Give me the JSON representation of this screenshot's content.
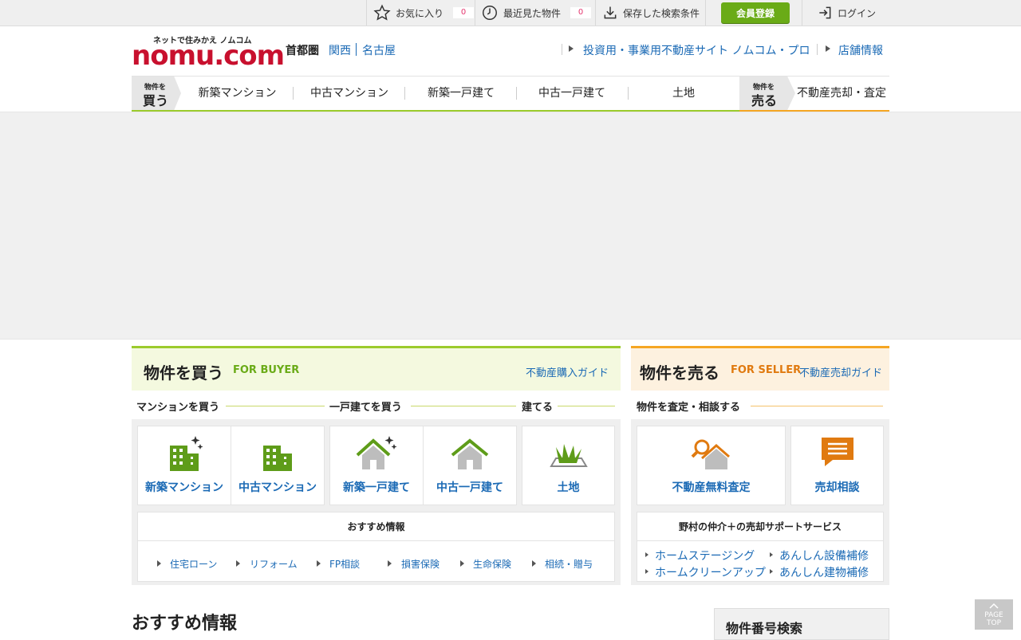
{
  "topbar": {
    "favorites_label": "お気に入り",
    "favorites_count": "0",
    "recent_label": "最近見た物件",
    "recent_count": "0",
    "saved_search_label": "保存した検索条件",
    "register_label": "会員登録",
    "login_label": "ログイン"
  },
  "header": {
    "logo_tagline": "ネットで住みかえ ノムコム",
    "logo_text": "nomu.com",
    "region_current": "首都圏",
    "region_kansai": "関西",
    "region_nagoya": "名古屋",
    "pro_site_link": "投資用・事業用不動産サイト ノムコム・プロ",
    "store_link": "店舗情報"
  },
  "gnav": {
    "buy_small": "物件を",
    "buy_large": "買う",
    "items": [
      "新築マンション",
      "中古マンション",
      "新築一戸建て",
      "中古一戸建て",
      "土地"
    ],
    "sell_small": "物件を",
    "sell_large": "売る",
    "sell_item": "不動産売却・査定"
  },
  "buyer": {
    "title": "物件を買う",
    "sub": "FOR BUYER",
    "guide": "不動産購入ガイド",
    "sub_mansion": "マンションを買う",
    "sub_house": "一戸建てを買う",
    "sub_build": "建てる",
    "cards": [
      "新築マンション",
      "中古マンション",
      "新築一戸建て",
      "中古一戸建て",
      "土地"
    ],
    "rec_title": "おすすめ情報",
    "rec_links": [
      "住宅ローン",
      "リフォーム",
      "FP相談",
      "損害保険",
      "生命保険",
      "相続・贈与"
    ]
  },
  "seller": {
    "title": "物件を売る",
    "sub": "FOR SELLER",
    "guide": "不動産売却ガイド",
    "sub_label": "物件を査定・相談する",
    "cards": [
      "不動産無料査定",
      "売却相談"
    ],
    "rec_title": "野村の仲介＋の売却サポートサービス",
    "rec_links": [
      "ホームステージング",
      "あんしん設備補修",
      "ホームクリーンアップ",
      "あんしん建物補修"
    ]
  },
  "bottom": {
    "section_title": "おすすめ情報",
    "number_search": "物件番号検索",
    "pagetop_line1": "PAGE",
    "pagetop_line2": "TOP"
  },
  "colors": {
    "green": "#9bcb2c",
    "orange": "#f5a623",
    "link": "#1b6ab5",
    "brand": "#c8102e"
  }
}
